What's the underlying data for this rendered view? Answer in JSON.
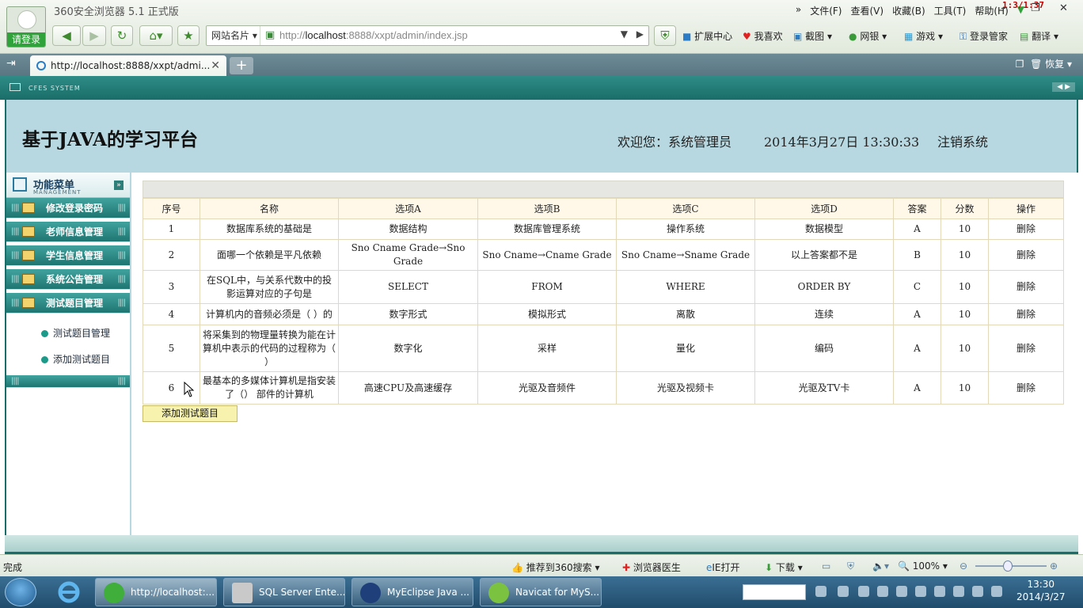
{
  "browser": {
    "title": "360安全浏览器 5.1 正式版",
    "login_label": "请登录",
    "menus": [
      "文件(F)",
      "查看(V)",
      "收藏(B)",
      "工具(T)",
      "帮助(H)"
    ],
    "perf_counter": "1:3/1:37",
    "site_card_label": "网站名片",
    "url_prefix": "http://",
    "url_host": "localhost",
    "url_rest": ":8888/xxpt/admin/index.jsp",
    "toolbar": [
      "扩展中心",
      "我喜欢",
      "截图",
      "网银",
      "游戏",
      "登录管家",
      "翻译"
    ],
    "tab_title": "http://localhost:8888/xxpt/admi...",
    "restore_label": "恢复",
    "status_text": "完成",
    "status_items": [
      "推荐到360搜索",
      "浏览器医生",
      "IE打开",
      "下载"
    ],
    "zoom": "100%",
    "zoom_level": 0.45
  },
  "app": {
    "system_label": "CFES SYSTEM",
    "site_title": "基于JAVA的学习平台",
    "welcome": "欢迎您：系统管理员",
    "datetime": "2014年3月27日  13:30:33",
    "logout": "注销系统",
    "menu_title": "功能菜单",
    "menu_subtitle": "MANAGEMENT",
    "menu_items": [
      "修改登录密码",
      "老师信息管理",
      "学生信息管理",
      "系统公告管理",
      "测试题目管理"
    ],
    "sub_items": [
      "测试题目管理",
      "添加测试题目"
    ],
    "columns": [
      "序号",
      "名称",
      "选项A",
      "选项B",
      "选项C",
      "选项D",
      "答案",
      "分数",
      "操作"
    ],
    "rows": [
      [
        "1",
        "数据库系统的基础是",
        "数据结构",
        "数据库管理系统",
        "操作系统",
        "数据模型",
        "A",
        "10",
        "删除"
      ],
      [
        "2",
        "面哪一个依赖是平凡依赖",
        "Sno Cname Grade→Sno Grade",
        "Sno Cname→Cname Grade",
        "Sno Cname→Sname Grade",
        "以上答案都不是",
        "B",
        "10",
        "删除"
      ],
      [
        "3",
        "在SQL中，与关系代数中的投影运算对应的子句是",
        "SELECT",
        "FROM",
        "WHERE",
        "ORDER BY",
        "C",
        "10",
        "删除"
      ],
      [
        "4",
        "计算机内的音频必须是（ ）的",
        "数字形式",
        "模拟形式",
        "离散",
        "连续",
        "A",
        "10",
        "删除"
      ],
      [
        "5",
        "将采集到的物理量转换为能在计算机中表示的代码的过程称为（ ）",
        "数字化",
        "采样",
        "量化",
        "编码",
        "A",
        "10",
        "删除"
      ],
      [
        "6",
        "最基本的多媒体计算机是指安装了（） 部件的计算机",
        "高速CPU及高速缓存",
        "光驱及音频件",
        "光驱及视频卡",
        "光驱及TV卡",
        "A",
        "10",
        "删除"
      ]
    ],
    "add_button": "添加测试题目"
  },
  "taskbar": {
    "tasks": [
      "http://localhost:...",
      "SQL Server Ente...",
      "MyEclipse Java ...",
      "Navicat for MyS..."
    ],
    "time": "13:30",
    "date": "2014/3/27"
  },
  "colors": {
    "accent": "#1a6d69",
    "header_bg": "#b7d8e1",
    "menu_item": "#2e8c86",
    "table_head_bg": "#fff8e9"
  }
}
